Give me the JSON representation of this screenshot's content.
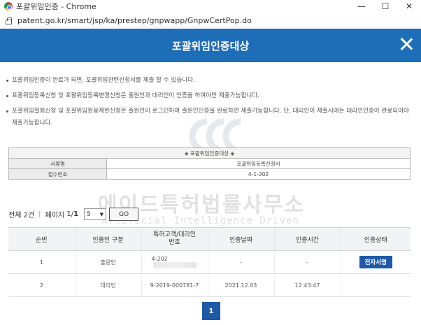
{
  "window": {
    "title": "포괄위임인증 - Chrome",
    "controls": {
      "minimize": "—",
      "maximize": "☐",
      "close": "✕"
    }
  },
  "address": {
    "url": "patent.go.kr/smart/jsp/ka/prestep/gnpwapp/GnpwCertPop.do"
  },
  "header": {
    "title": "포괄위임인증대상"
  },
  "notices": [
    "포괄위임인증이 완료가 되면, 포괄위임관련신청서를 제출 할 수 있습니다.",
    "포괄위임등록신청 및 포괄위임등록변경신청은 출원인과 대리인이 인증을 하여야만 제출가능합니다.",
    "포괄위임철회신청 및 포괄위임원용제한신청은 출원인이 로그인하여 출원인인증을 완료하면 제출가능합니다. 단, 대리인이 제출시에는 대리인인증이 완료되어야 제출가능합니다."
  ],
  "watermark": {
    "line1": "에이드특허법률사무소",
    "line2": "Artificial Intelligence Driven"
  },
  "info_table": {
    "caption": "◈ 포괄위임인증대상 ◈",
    "rows": [
      {
        "label": "서류명",
        "value": "포괄위임등록신청서"
      },
      {
        "label": "접수번호",
        "value": "4-1-202"
      }
    ]
  },
  "pager": {
    "total_label": "전체 2건",
    "page_label": "페이지",
    "page_current": "1",
    "page_total": "1",
    "page_size": "5",
    "go_label": "GO"
  },
  "list_table": {
    "headers": [
      "순번",
      "인증인 구분",
      "특허고객/대리인번호",
      "인증날짜",
      "인증시간",
      "인증상태"
    ],
    "rows": [
      {
        "no": "1",
        "type": "출원인",
        "number": "4-202",
        "date": "-",
        "time": "-",
        "status": "전자서명"
      },
      {
        "no": "2",
        "type": "대리인",
        "number": "9-2019-000781-7",
        "date": "2021.12.03",
        "time": "12:43:47",
        "status": ""
      }
    ]
  },
  "pagination": {
    "current": "1"
  },
  "colors": {
    "header_blue": "#1e6db7",
    "button_blue": "#1e5aa8"
  }
}
